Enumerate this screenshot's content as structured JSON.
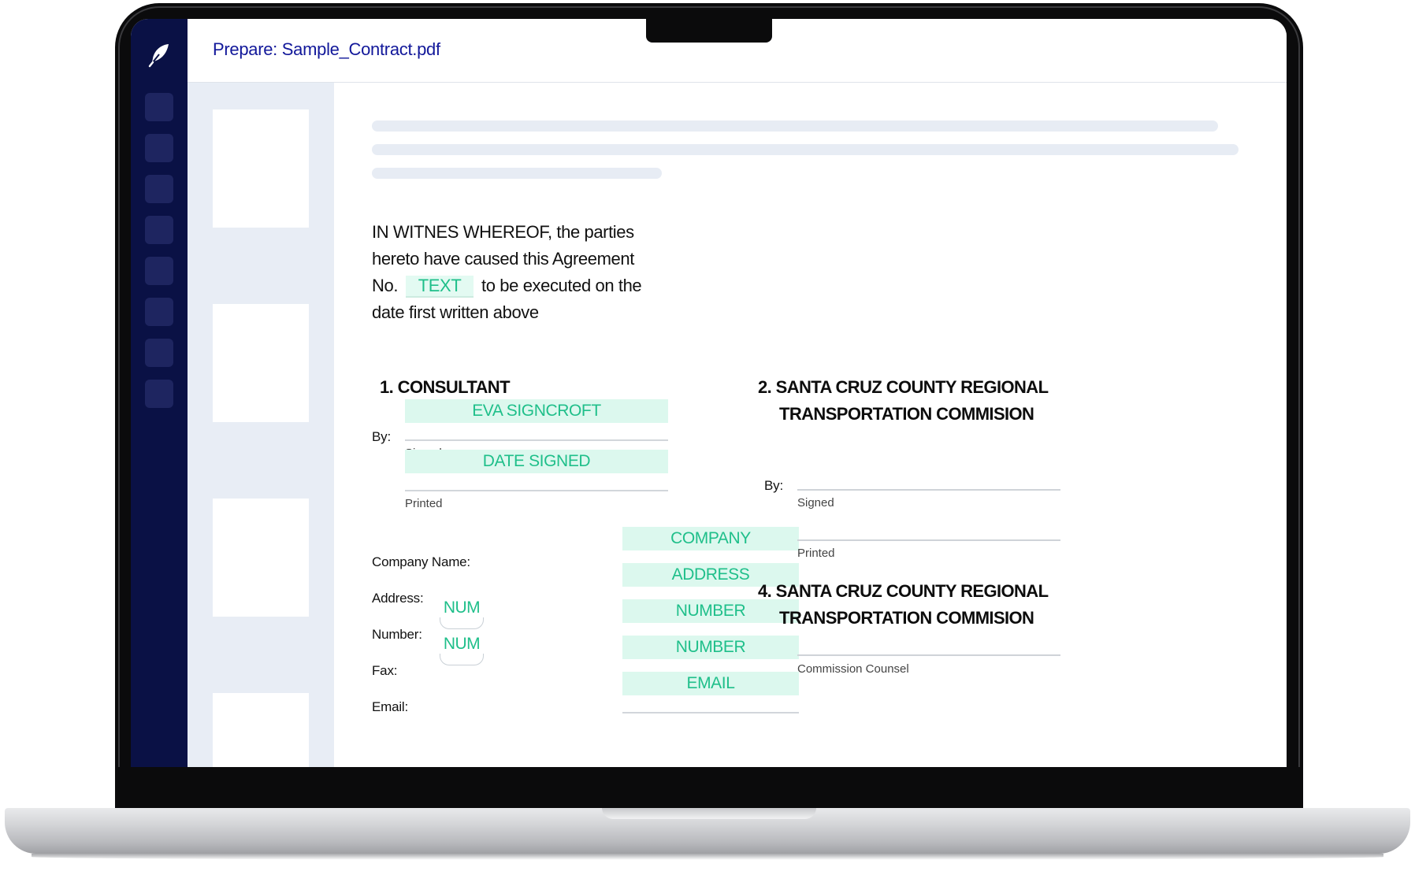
{
  "app": {
    "title": "Prepare: Sample_Contract.pdf",
    "logo_icon": "feather-icon",
    "accent_color": "#12189a",
    "field_color": "#1fbf8a",
    "field_bg": "#dcf8ee"
  },
  "sidebar": {
    "buttons": [
      "rail-button-1",
      "rail-button-2",
      "rail-button-3",
      "rail-button-4",
      "rail-button-5",
      "rail-button-6",
      "rail-button-7",
      "rail-button-8"
    ]
  },
  "document": {
    "paragraph": {
      "line1": "IN WITNES WHEREOF, the parties",
      "line2": "hereto have caused this Agreement",
      "prefix": "No.",
      "text_field": "TEXT",
      "suffix": "to be executed on the",
      "line4": "date first written above"
    },
    "consultant": {
      "heading": "1. CONSULTANT",
      "by_label": "By:",
      "signature_field": "EVA SIGNCROFT",
      "signed_label": "Signed",
      "date_field": "DATE SIGNED",
      "printed_label": "Printed",
      "company_label": "Company Name:",
      "company_field": "COMPANY",
      "address_label": "Address:",
      "address_field": "ADDRESS",
      "number_label": "Number:",
      "number_area_field": "NUM",
      "number_field": "NUMBER",
      "fax_label": "Fax:",
      "fax_area_field": "NUM",
      "fax_field": "NUMBER",
      "email_label": "Email:",
      "email_field": "EMAIL"
    },
    "commission": {
      "heading_line1": "2. SANTA CRUZ COUNTY REGIONAL",
      "heading_line2": "TRANSPORTATION COMMISION",
      "by_label": "By:",
      "signed_label": "Signed",
      "printed_label": "Printed"
    },
    "counsel": {
      "heading_line1": "4. SANTA CRUZ COUNTY REGIONAL",
      "heading_line2": "TRANSPORTATION COMMISION",
      "counsel_label": "Commission Counsel"
    }
  }
}
